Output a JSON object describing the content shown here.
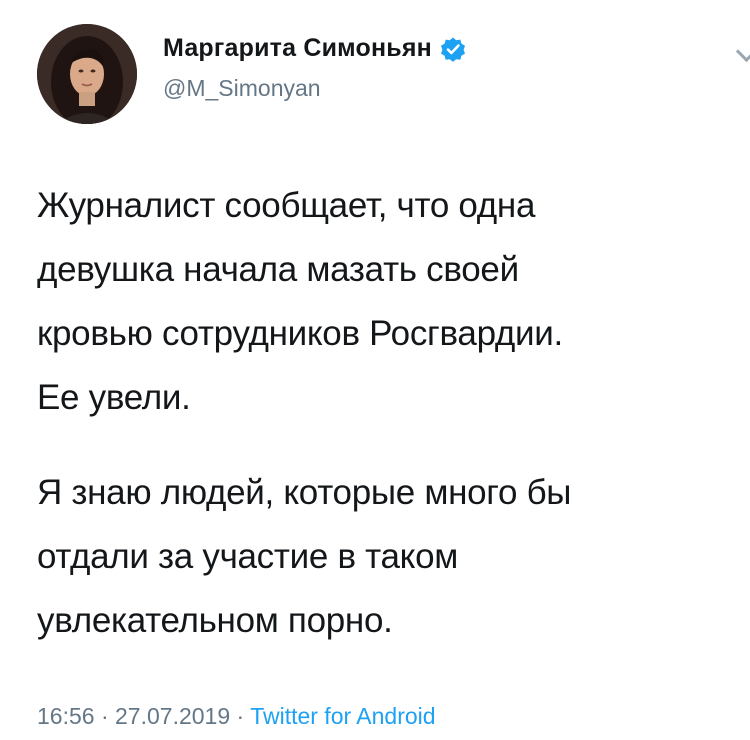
{
  "tweet": {
    "display_name": "Маргарита Симоньян",
    "handle": "@M_Simonyan",
    "verified": true,
    "paragraphs": [
      "Журналист сообщает, что одна\nдевушка начала мазать своей\nкровью сотрудников Росгвардии.\nЕе увели.",
      "Я знаю людей, которые много бы\nотдали за участие в таком\nувлекательном порно."
    ],
    "time": "16:56",
    "separator": "·",
    "date": "27.07.2019",
    "source": "Twitter for Android"
  },
  "colors": {
    "text": "#14171a",
    "secondary": "#657786",
    "accent": "#1da1f2"
  },
  "icons": {
    "verified": "verified-badge-icon",
    "more": "chevron-down-icon"
  }
}
